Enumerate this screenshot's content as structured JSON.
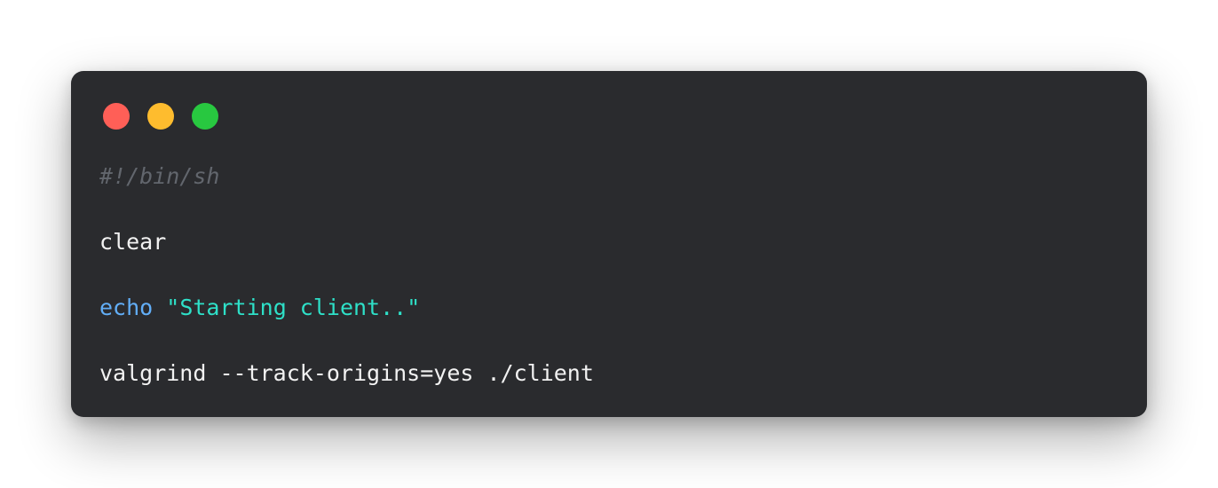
{
  "window": {
    "buttons": [
      {
        "name": "close",
        "color": "#ff5f57"
      },
      {
        "name": "minimize",
        "color": "#febc2e"
      },
      {
        "name": "zoom",
        "color": "#28c840"
      }
    ]
  },
  "code": {
    "line1": "#!/bin/sh",
    "line3": "clear",
    "line5_keyword": "echo",
    "line5_string": "\"Starting client..\"",
    "line7": "valgrind --track-origins=yes ./client"
  },
  "colors": {
    "background": "#2a2b2e",
    "comment": "#62666d",
    "keyword": "#62aef7",
    "string": "#2ee0c8",
    "text": "#f2f2f2"
  }
}
